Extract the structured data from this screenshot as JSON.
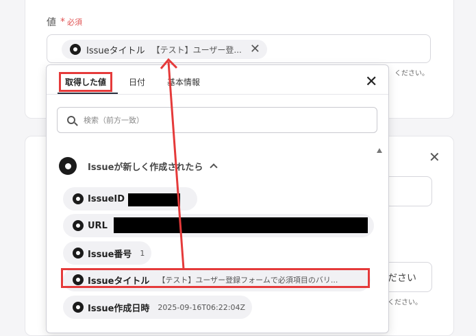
{
  "form": {
    "value_label": "値",
    "required_star": "*",
    "required_text": "必須",
    "chip": {
      "name": "Issueタイトル",
      "value": "【テスト】ユーザー登...",
      "remove": "✕"
    },
    "hint_text": "ください。",
    "card2_close": "✕",
    "ghost_input_text": "ださい",
    "hint_text_2": "ください。"
  },
  "popup": {
    "tabs": [
      {
        "label": "取得した値",
        "active": true
      },
      {
        "label": "日付"
      },
      {
        "label": "基本情報"
      }
    ],
    "close": "✕",
    "search_placeholder": "検索（前方一致）",
    "section_title": "Issueが新しく作成されたら",
    "items": [
      {
        "label": "IssueID",
        "value": ""
      },
      {
        "label": "URL",
        "value": ""
      },
      {
        "label": "Issue番号",
        "value": "1"
      },
      {
        "label": "Issueタイトル",
        "value": "【テスト】ユーザー登録フォームで必須項目のバリ..."
      },
      {
        "label": "Issue作成日時",
        "value": "2025-09-16T06:22:04Z"
      }
    ]
  },
  "colors": {
    "annotation_red": "#e53a3a",
    "github_icon": "#1b1b1b"
  }
}
